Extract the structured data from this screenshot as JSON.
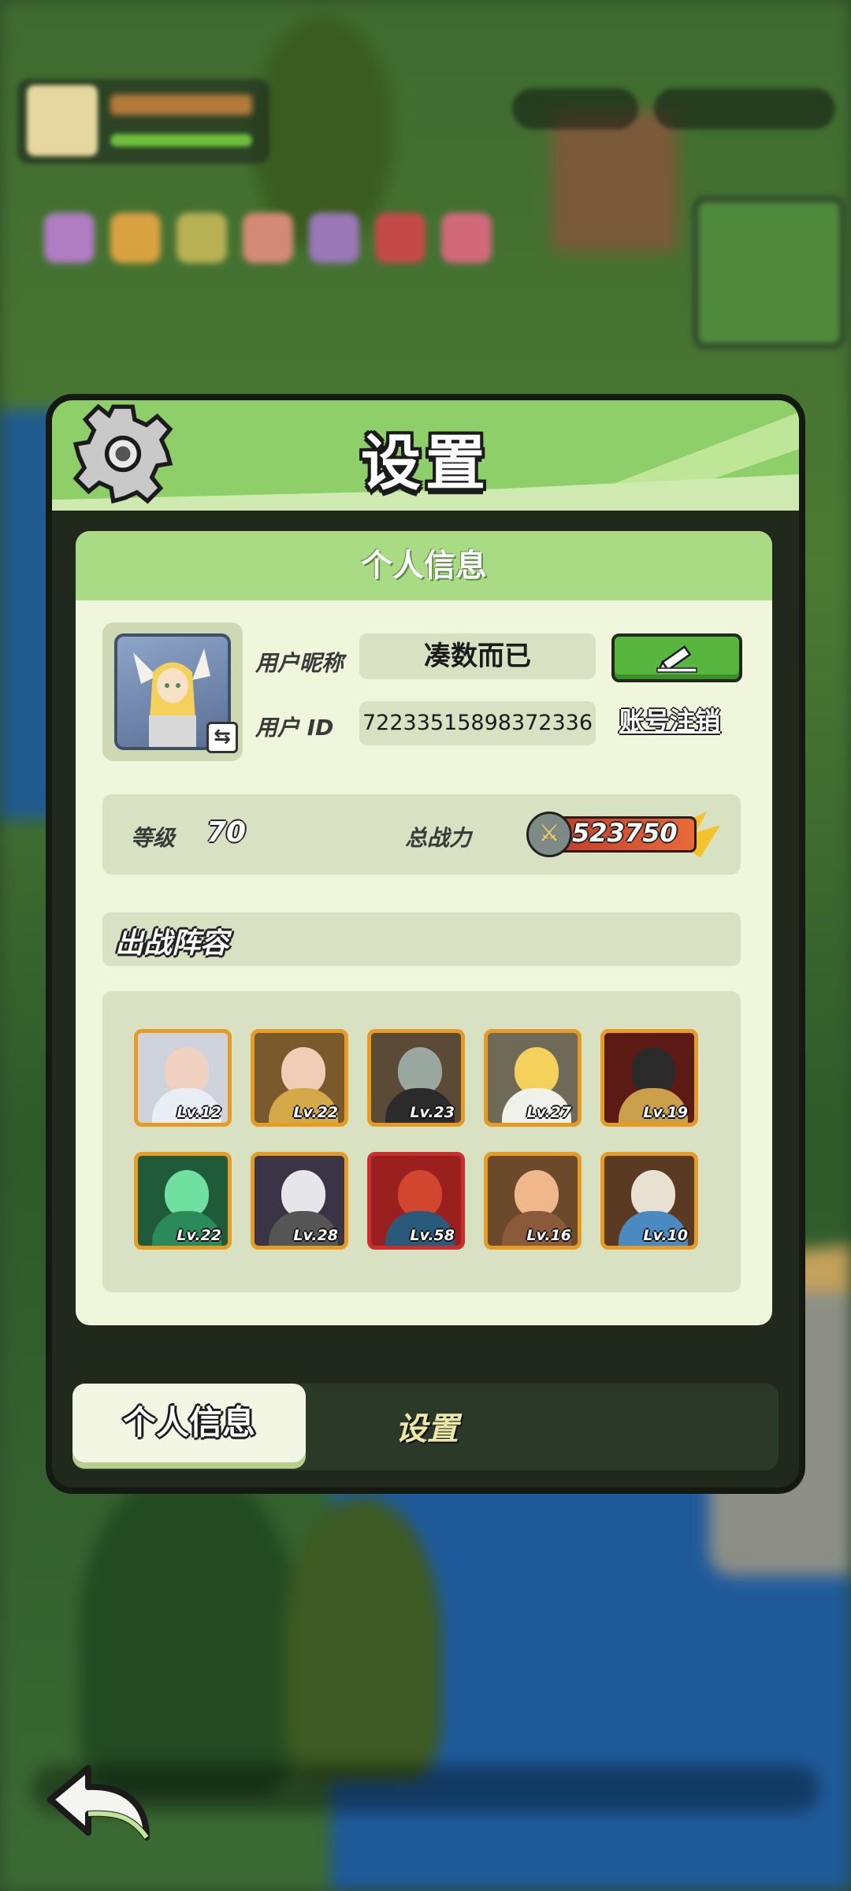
{
  "panel": {
    "title": "设置",
    "section_header": "个人信息"
  },
  "profile": {
    "nickname_label": "用户昵称",
    "nickname": "凑数而已",
    "id_label": "用户 ID",
    "user_id": "72233515898372336",
    "account_cancel_label": "账号注销"
  },
  "stats": {
    "level_label": "等级",
    "level": "70",
    "power_label": "总战力",
    "power": "523750"
  },
  "team": {
    "title": "出战阵容",
    "heroes": [
      {
        "level": "Lv.12"
      },
      {
        "level": "Lv.22"
      },
      {
        "level": "Lv.23"
      },
      {
        "level": "Lv.27"
      },
      {
        "level": "Lv.19"
      },
      {
        "level": "Lv.22"
      },
      {
        "level": "Lv.28"
      },
      {
        "level": "Lv.58"
      },
      {
        "level": "Lv.16"
      },
      {
        "level": "Lv.10"
      }
    ]
  },
  "tabs": {
    "profile": "个人信息",
    "settings": "设置"
  }
}
